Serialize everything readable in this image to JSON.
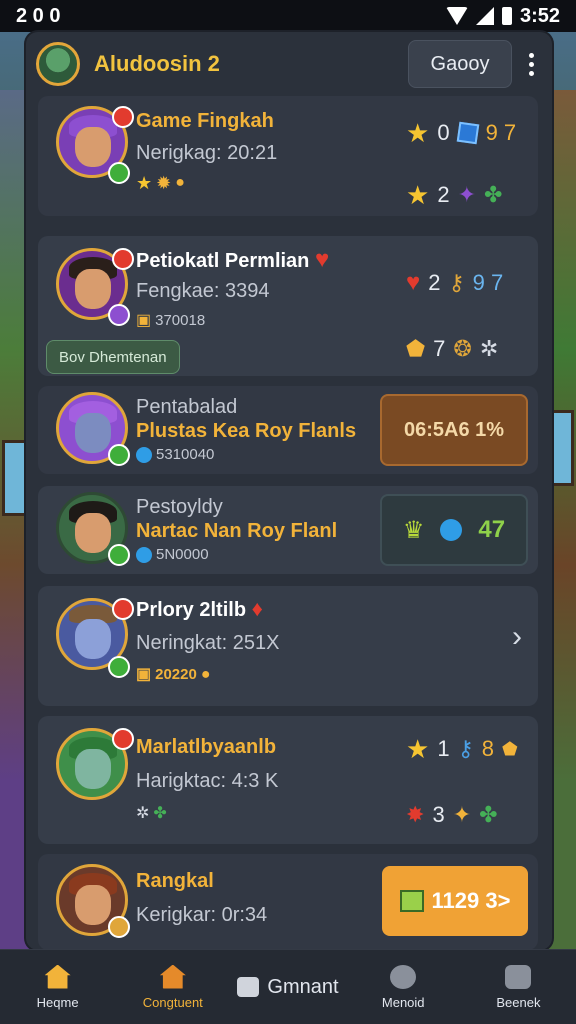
{
  "status_bar": {
    "time": "2 0 0",
    "clock": "3:52"
  },
  "header": {
    "title": "Aludoosin 2",
    "button_label": "Gaooy"
  },
  "items": [
    {
      "name": "Game Fingkah",
      "subtitle": "Nerigkag: 20:21",
      "stat1": {
        "a": "0",
        "b": "9 7"
      },
      "stat2": {
        "a": "2"
      }
    },
    {
      "name": "Petiokatl Permlian",
      "subtitle": "Fengkae: 3394",
      "code": "370018",
      "tag": "Bov Dhemtenan",
      "stat1": {
        "a": "2",
        "b": "9 7"
      },
      "stat2": {
        "a": "7"
      }
    },
    {
      "name": "Pentabalad",
      "subtitle": "Plustas Kea Roy Flanls",
      "code": "5310040",
      "box": "06:5A6 1%"
    },
    {
      "name": "Pestoyldy",
      "subtitle": "Nartac Nan Roy Flanl",
      "code": "5N0000",
      "box_value": "47"
    },
    {
      "name": "Prlory 2ltilb",
      "subtitle": "Neringkat: 251X",
      "code": "20220"
    },
    {
      "name": "Marlatlbyaanlb",
      "subtitle": "Harigktac: 4:3 K",
      "stat1": {
        "a": "1",
        "b": "8"
      },
      "stat2": {
        "a": "3"
      }
    },
    {
      "name": "Rangkal",
      "subtitle": "Kerigkar: 0r:34",
      "box": "1129 3>"
    }
  ],
  "bottom_nav": [
    {
      "label": "Heqme",
      "icon": "home-icon"
    },
    {
      "label": "Congtuent",
      "icon": "house-icon"
    },
    {
      "label": "Gmnant",
      "icon": "bag-icon"
    },
    {
      "label": "Menoid",
      "icon": "chat-icon"
    },
    {
      "label": "Beenek",
      "icon": "book-icon"
    }
  ],
  "colors": {
    "accent": "#f2b33a",
    "panel": "#2b313b",
    "card": "#363d49",
    "orange": "#f0a235"
  }
}
